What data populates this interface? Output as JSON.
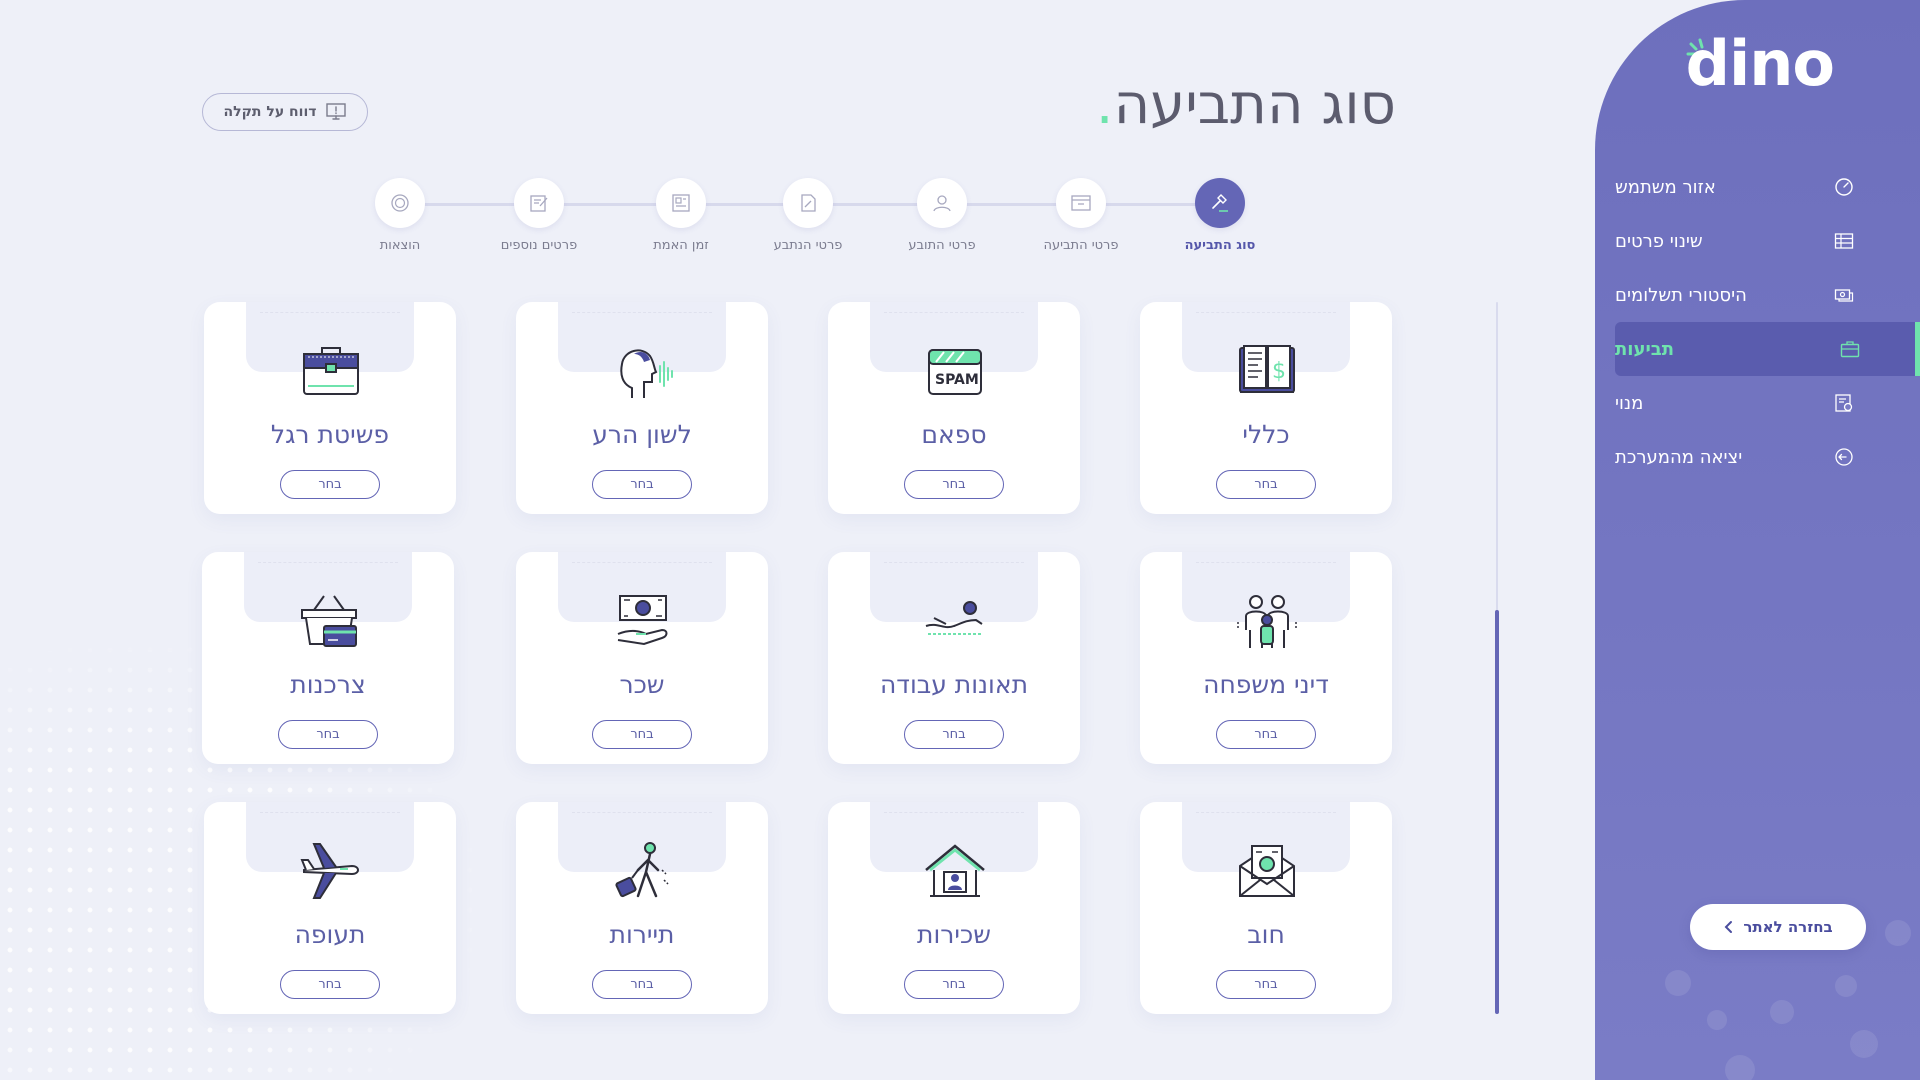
{
  "app": {
    "logo": "dino"
  },
  "sidebar": {
    "items": [
      {
        "label": "אזור משתמש",
        "icon": "speedometer-icon",
        "active": false
      },
      {
        "label": "שינוי פרטים",
        "icon": "table-icon",
        "active": false
      },
      {
        "label": "היסטורי תשלומים",
        "icon": "payment-icon",
        "active": false
      },
      {
        "label": "תביעות",
        "icon": "briefcase-icon",
        "active": true
      },
      {
        "label": "מנוי",
        "icon": "subscription-icon",
        "active": false
      },
      {
        "label": "יציאה מהמערכת",
        "icon": "logout-icon",
        "active": false
      }
    ],
    "back_label": "בחזרה לאתר"
  },
  "header": {
    "title": "סוג התביעה",
    "title_dot": ".",
    "report_label": "דווח על תקלה"
  },
  "stepper": {
    "steps": [
      {
        "label": "סוג התביעה",
        "icon": "gavel-icon",
        "active": true
      },
      {
        "label": "פרטי התביעה",
        "icon": "archive-icon",
        "active": false
      },
      {
        "label": "פרטי התובע",
        "icon": "user-icon",
        "active": false
      },
      {
        "label": "פרטי הנתבע",
        "icon": "document-icon",
        "active": false
      },
      {
        "label": "זמן האמת",
        "icon": "image-doc-icon",
        "active": false
      },
      {
        "label": "פרטים נוספים",
        "icon": "edit-doc-icon",
        "active": false
      },
      {
        "label": "הוצאות",
        "icon": "coin-icon",
        "active": false
      }
    ]
  },
  "cards": {
    "choose_label": "בחר",
    "items": [
      {
        "label": "כללי",
        "icon": "book-icon"
      },
      {
        "label": "ספאם",
        "icon": "spam-icon"
      },
      {
        "label": "לשון הרע",
        "icon": "speaking-head-icon"
      },
      {
        "label": "פשיטת רגל",
        "icon": "briefcase-icon"
      },
      {
        "label": "דיני משפחה",
        "icon": "family-icon"
      },
      {
        "label": "תאונות עבודה",
        "icon": "injury-icon"
      },
      {
        "label": "שכר",
        "icon": "salary-icon"
      },
      {
        "label": "צרכנות",
        "icon": "basket-icon"
      },
      {
        "label": "חוב",
        "icon": "envelope-money-icon"
      },
      {
        "label": "שכירות",
        "icon": "house-icon"
      },
      {
        "label": "תיירות",
        "icon": "traveler-icon"
      },
      {
        "label": "תעופה",
        "icon": "airplane-icon"
      }
    ]
  },
  "colors": {
    "brand": "#6d6fbd",
    "accent": "#6fe3ad",
    "card_text": "#5b5fa6",
    "background": "#eef0f8"
  }
}
